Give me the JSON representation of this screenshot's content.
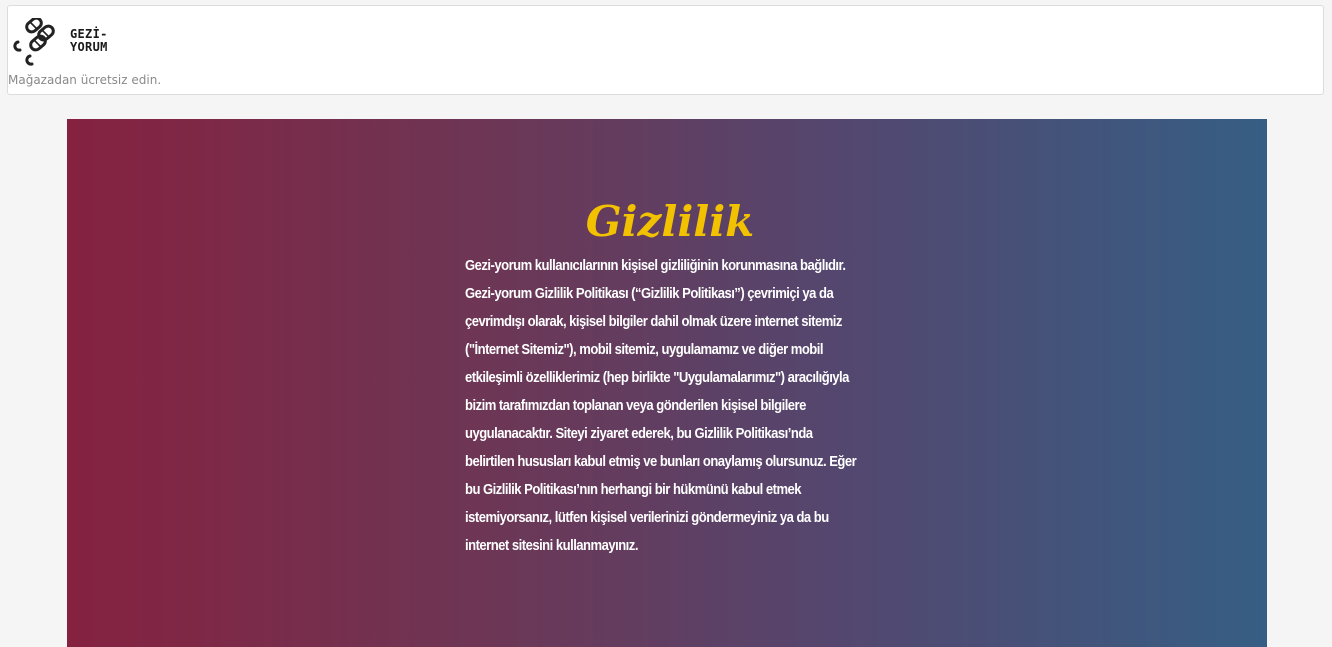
{
  "header": {
    "logo": {
      "line1": "GEZİ-",
      "line2": "YORUM",
      "icon": "chain-links-icon"
    },
    "store_text": "Mağazadan ücretsiz edin."
  },
  "hero": {
    "title": "Gizlilik",
    "body": "Gezi-yorum kullanıcılarının kişisel gizliliğinin korunmasına bağlıdır. Gezi-yorum Gizlilik Politikası (“Gizlilik Politikası”) çevrimiçi ya da çevrimdışı olarak, kişisel bilgiler dahil olmak üzere internet sitemiz (\"İnternet Sitemiz\"), mobil sitemiz, uygulamamız ve diğer mobil etkileşimli özelliklerimiz (hep birlikte \"Uygulamalarımız\") aracılığıyla bizim tarafımızdan toplanan veya gönderilen kişisel bilgilere uygulanacaktır. Siteyi ziyaret ederek, bu Gizlilik Politikası’nda belirtilen hususları kabul etmiş ve bunları onaylamış olursunuz. Eğer bu Gizlilik Politikası’nın herhangi bir hükmünü kabul etmek istemiyorsanız, lütfen kişisel verilerinizi göndermeyiniz ya da bu internet sitesini kullanmayınız.",
    "colors": {
      "gradient_start": "#852240",
      "gradient_end": "#365e84",
      "title": "#f2c200",
      "text": "#ffffff"
    }
  }
}
